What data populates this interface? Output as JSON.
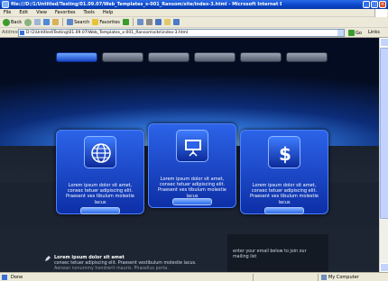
{
  "window": {
    "title": "file:///D:/1/Untitled/Testing/01.09.07/Web_Templates_x-001_Ransom/site/index-3.html - Microsoft Internet Explorer",
    "controls": [
      "_",
      "□",
      "×"
    ]
  },
  "menu": {
    "items": [
      "File",
      "Edit",
      "View",
      "Favorites",
      "Tools",
      "Help"
    ]
  },
  "toolbar": {
    "back_label": "Back",
    "search_label": "Search",
    "favorites_label": "Favorites"
  },
  "address_bar": {
    "label": "Address",
    "value": "D:\\1\\Untitled\\Testing\\01.09.07\\Web_Templates_x-001_Ransom\\site\\index-3.html",
    "go_label": "Go",
    "links_label": "Links"
  },
  "page": {
    "nav_tab_count": 6,
    "active_tab_index": 0,
    "cards": [
      {
        "icon": "globe-icon",
        "text": "Lorem ipsum dolor sit amet, consec tetuer adipiscing elit. Praesent ves tibulum molestie lacus"
      },
      {
        "icon": "presentation-board-icon",
        "text": "Lorem ipsum dolor sit amet, consec tetuer adipiscing elit. Praesent ves tibulum molestie lacus"
      },
      {
        "icon": "dollar-icon",
        "text": "Lorem ipsum dolor sit amet, consec tetuer adipiscing elit. Praesent ves tibulum molestie lacus"
      }
    ],
    "news": {
      "title": "Lorem ipsum dolor sit amet",
      "line1": "consec tetuer adipiscing elit. Praesent vestibulum molestie lacus.",
      "line2": "Aenean nonummy hendrerit mauris. Phasellus porta."
    },
    "mailing": {
      "text": "enter your email below to join our mailing list"
    }
  },
  "status_bar": {
    "text": "Done",
    "zone": "My Computer"
  },
  "colors": {
    "title_bar": "#0a46c8",
    "card_blue": "#2c63e8",
    "page_bg": "#1c2330"
  }
}
